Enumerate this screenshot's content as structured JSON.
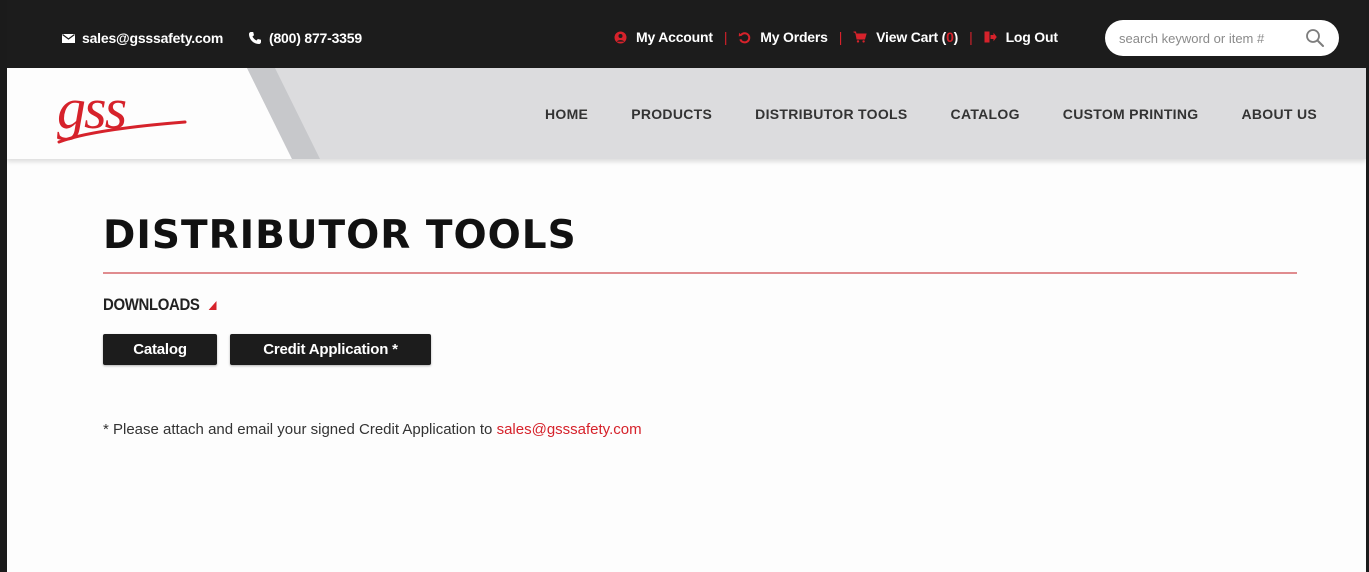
{
  "topbar": {
    "email": "sales@gsssafety.com",
    "phone": "(800) 877-3359",
    "my_account": "My Account",
    "my_orders": "My Orders",
    "view_cart": "View Cart (",
    "cart_count": "0",
    "cart_close": ")",
    "log_out": "Log Out",
    "search_placeholder": "search keyword or item #"
  },
  "brand": {
    "logo_text": "gss",
    "accent_color": "#d6222b"
  },
  "nav": {
    "home": "HOME",
    "products": "PRODUCTS",
    "distributor_tools": "DISTRIBUTOR TOOLS",
    "catalog": "CATALOG",
    "custom_printing": "CUSTOM PRINTING",
    "about_us": "ABOUT US"
  },
  "page": {
    "title": "DISTRIBUTOR TOOLS",
    "section_label": "DOWNLOADS",
    "buttons": {
      "catalog": "Catalog",
      "credit_application": "Credit Application *"
    },
    "note_prefix": "* Please attach and email your signed Credit Application to ",
    "note_email": "sales@gsssafety.com"
  }
}
